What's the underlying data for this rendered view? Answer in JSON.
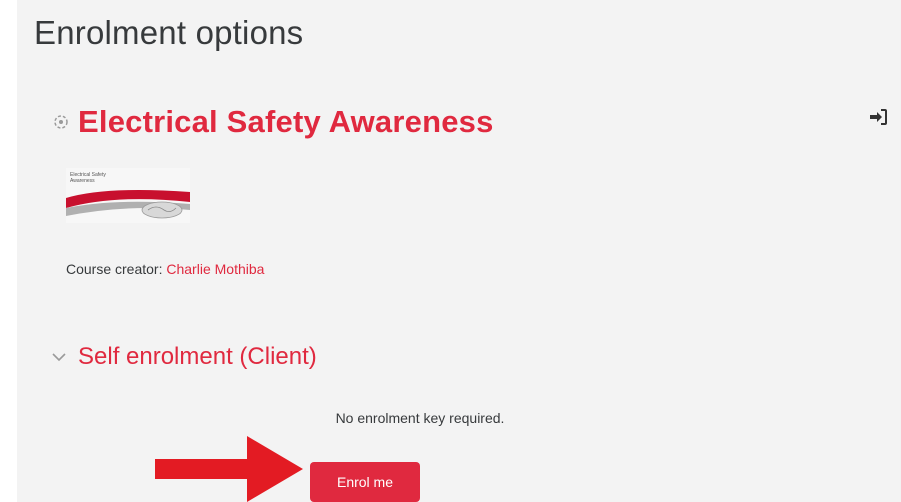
{
  "page": {
    "title": "Enrolment options"
  },
  "course": {
    "name": "Electrical Safety Awareness",
    "thumbnail_text": "Electrical Safety Awareness",
    "creator_label": "Course creator:",
    "creator_name": "Charlie Mothiba",
    "icon": "course-icon",
    "enrol_icon": "enrol-icon"
  },
  "enrolment": {
    "section_title": "Self enrolment (Client)",
    "message": "No enrolment key required.",
    "button_label": "Enrol me",
    "toggle_icon": "chevron-down-icon"
  },
  "annotation": {
    "icon": "arrow-right-icon",
    "color": "#e31b23"
  },
  "colors": {
    "accent": "#e0293f",
    "panel_bg": "#f3f3f3",
    "text": "#373a3c"
  }
}
